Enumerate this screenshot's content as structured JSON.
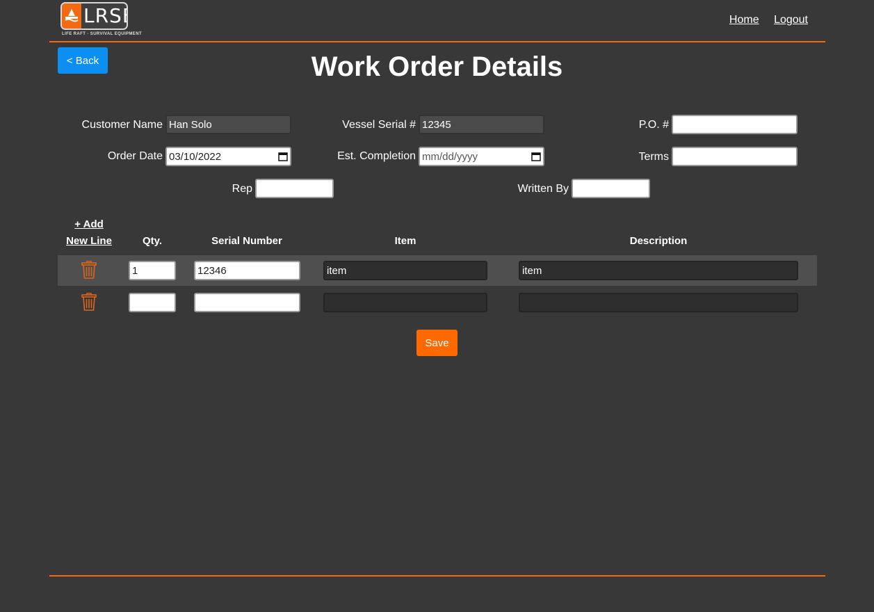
{
  "header": {
    "logo_text": "LRSE",
    "logo_tagline": "LIFE RAFT · SURVIVAL EQUIPMENT",
    "nav": {
      "home": "Home",
      "logout": "Logout"
    }
  },
  "back_button": "< Back",
  "page_title": "Work Order Details",
  "form": {
    "customer_name": {
      "label": "Customer Name",
      "value": "Han Solo"
    },
    "vessel_serial": {
      "label": "Vessel Serial #",
      "value": "12345"
    },
    "po_number": {
      "label": "P.O. #",
      "value": ""
    },
    "order_date": {
      "label": "Order Date",
      "value": "03/10/2022"
    },
    "est_completion": {
      "label": "Est. Completion",
      "value": "mm/dd/yyyy"
    },
    "terms": {
      "label": "Terms",
      "value": ""
    },
    "rep": {
      "label": "Rep",
      "value": ""
    },
    "written_by": {
      "label": "Written By",
      "value": ""
    }
  },
  "table": {
    "add_line_1": "+ Add",
    "add_line_2": "New Line",
    "headers": {
      "qty": "Qty.",
      "serial": "Serial Number",
      "item": "Item",
      "description": "Description"
    },
    "rows": [
      {
        "qty": "1",
        "serial": "12346",
        "item": "item",
        "description": "item"
      },
      {
        "qty": "",
        "serial": "",
        "item": "",
        "description": ""
      }
    ]
  },
  "save_button": "Save",
  "colors": {
    "accent": "#f36a10",
    "primary_button": "#0b8ff0",
    "save_button": "#ff6a00",
    "background": "#383838"
  },
  "icons": {
    "delete": "trash-icon",
    "calendar": "calendar-icon"
  }
}
